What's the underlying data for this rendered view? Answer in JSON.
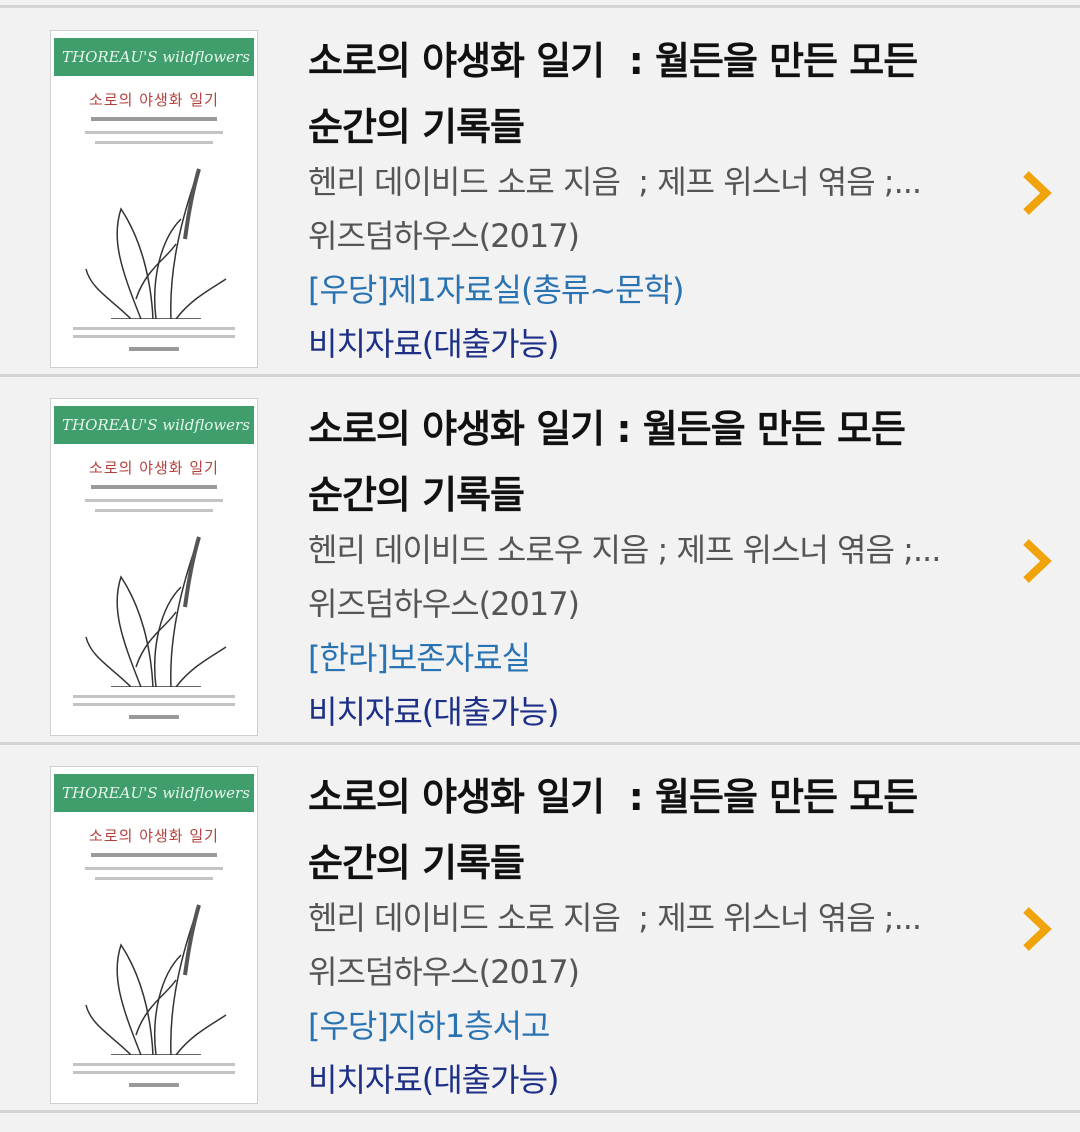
{
  "colors": {
    "background": "#f2f2f2",
    "title": "#111111",
    "meta": "#555555",
    "location": "#2a73b3",
    "status": "#1d2f86",
    "chevron": "#f0a30a",
    "cover_band": "#3f9e6b",
    "cover_title": "#b5423d"
  },
  "cover": {
    "band_text": "THOREAU'S wildflowers",
    "title_text": "소로의 야생화 일기",
    "icon": "book-cover-image"
  },
  "results": [
    {
      "title_line1": "소로의 야생화 일기  : 월든을 만든 모든",
      "title_line2": "순간의 기록들",
      "author": "헨리 데이비드 소로 지음  ; 제프 위스너 엮음 ;...",
      "publisher": "위즈덤하우스(2017)",
      "location": "[우당]제1자료실(총류~문학)",
      "status": "비치자료(대출가능)",
      "action_icon": "chevron-right-icon"
    },
    {
      "title_line1": "소로의 야생화 일기 : 월든을 만든 모든",
      "title_line2": "순간의 기록들",
      "author": "헨리 데이비드 소로우 지음 ; 제프 위스너 엮음 ;...",
      "publisher": "위즈덤하우스(2017)",
      "location": "[한라]보존자료실",
      "status": "비치자료(대출가능)",
      "action_icon": "chevron-right-icon"
    },
    {
      "title_line1": "소로의 야생화 일기  : 월든을 만든 모든",
      "title_line2": "순간의 기록들",
      "author": "헨리 데이비드 소로 지음  ; 제프 위스너 엮음 ;...",
      "publisher": "위즈덤하우스(2017)",
      "location": "[우당]지하1층서고",
      "status": "비치자료(대출가능)",
      "action_icon": "chevron-right-icon"
    }
  ]
}
